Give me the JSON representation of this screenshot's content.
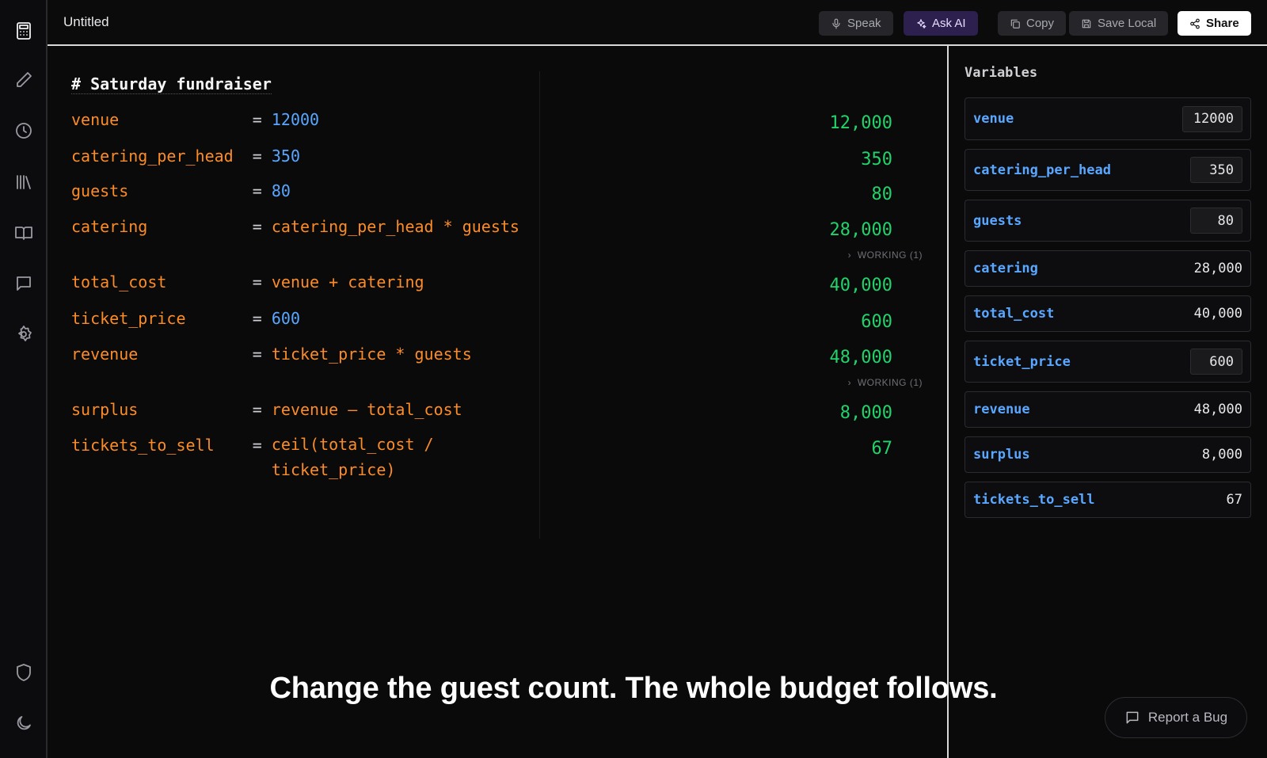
{
  "header": {
    "title": "Untitled",
    "buttons": {
      "speak": "Speak",
      "ask_ai": "Ask AI",
      "copy": "Copy",
      "save_local": "Save Local",
      "share": "Share"
    }
  },
  "sidebar": {
    "top_icons": [
      "calculator-icon",
      "pencil-icon",
      "clock-icon",
      "library-icon",
      "book-icon",
      "chat-icon",
      "gear-icon"
    ],
    "bottom_icons": [
      "shield-icon",
      "moon-icon"
    ]
  },
  "editor": {
    "heading": "# Saturday fundraiser",
    "lines": [
      {
        "name": "venue",
        "expr": "12000",
        "result": "12,000"
      },
      {
        "name": "catering_per_head",
        "expr": "350",
        "result": "350"
      },
      {
        "name": "guests",
        "expr": "80",
        "result": "80"
      },
      {
        "name": "catering",
        "expr": "catering_per_head * guests",
        "result": "28,000",
        "working": "WORKING (1)"
      },
      {
        "name": "total_cost",
        "expr": "venue + catering",
        "result": "40,000"
      },
      {
        "name": "ticket_price",
        "expr": "600",
        "result": "600"
      },
      {
        "name": "revenue",
        "expr": "ticket_price * guests",
        "result": "48,000",
        "working": "WORKING (1)"
      },
      {
        "name": "surplus",
        "expr": "revenue – total_cost",
        "result": "8,000"
      },
      {
        "name": "tickets_to_sell",
        "expr": "ceil(total_cost / ticket_price)",
        "result": "67"
      }
    ]
  },
  "variables_panel": {
    "title": "Variables",
    "items": [
      {
        "name": "venue",
        "value": "12000",
        "editable": true
      },
      {
        "name": "catering_per_head",
        "value": "350",
        "editable": true
      },
      {
        "name": "guests",
        "value": "80",
        "editable": true
      },
      {
        "name": "catering",
        "value": "28,000",
        "editable": false
      },
      {
        "name": "total_cost",
        "value": "40,000",
        "editable": false
      },
      {
        "name": "ticket_price",
        "value": "600",
        "editable": true
      },
      {
        "name": "revenue",
        "value": "48,000",
        "editable": false
      },
      {
        "name": "surplus",
        "value": "8,000",
        "editable": false
      },
      {
        "name": "tickets_to_sell",
        "value": "67",
        "editable": false
      }
    ]
  },
  "caption": "Change the guest count. The whole budget follows.",
  "report_bug_label": "Report a Bug",
  "colors": {
    "variable": "#fb8c28",
    "number": "#5aa7ff",
    "result": "#22d36b",
    "accent_ai": "#2d1f4e"
  }
}
